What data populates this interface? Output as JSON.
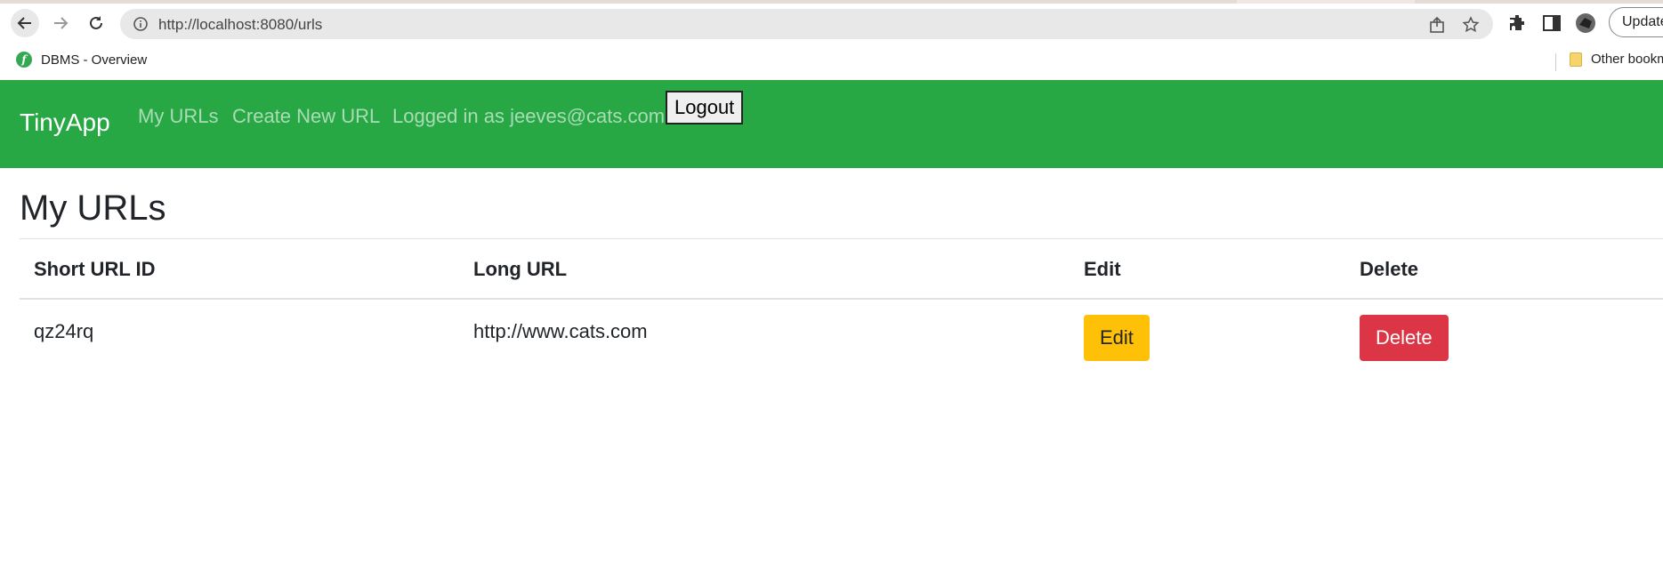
{
  "browser": {
    "url": "http://localhost:8080/urls",
    "update_label": "Update",
    "bookmarks": [
      {
        "label": "DBMS - Overview",
        "favicon_letter": "f"
      }
    ],
    "other_bookmarks_label": "Other bookmarks",
    "colors": {
      "favicon": "#34a853",
      "folder": "#f6d36b"
    }
  },
  "navbar": {
    "brand": "TinyApp",
    "links": [
      "My URLs",
      "Create New URL"
    ],
    "logged_in_text": "Logged in as jeeves@cats.com",
    "logout_label": "Logout",
    "colors": {
      "background": "#28a745"
    }
  },
  "main": {
    "title": "My URLs",
    "table": {
      "headers": [
        "Short URL ID",
        "Long URL",
        "Edit",
        "Delete"
      ],
      "rows": [
        {
          "short_id": "qz24rq",
          "long_url": "http://www.cats.com",
          "edit_label": "Edit",
          "delete_label": "Delete"
        }
      ]
    },
    "colors": {
      "edit_button": "#ffc107",
      "delete_button": "#dc3545"
    }
  }
}
